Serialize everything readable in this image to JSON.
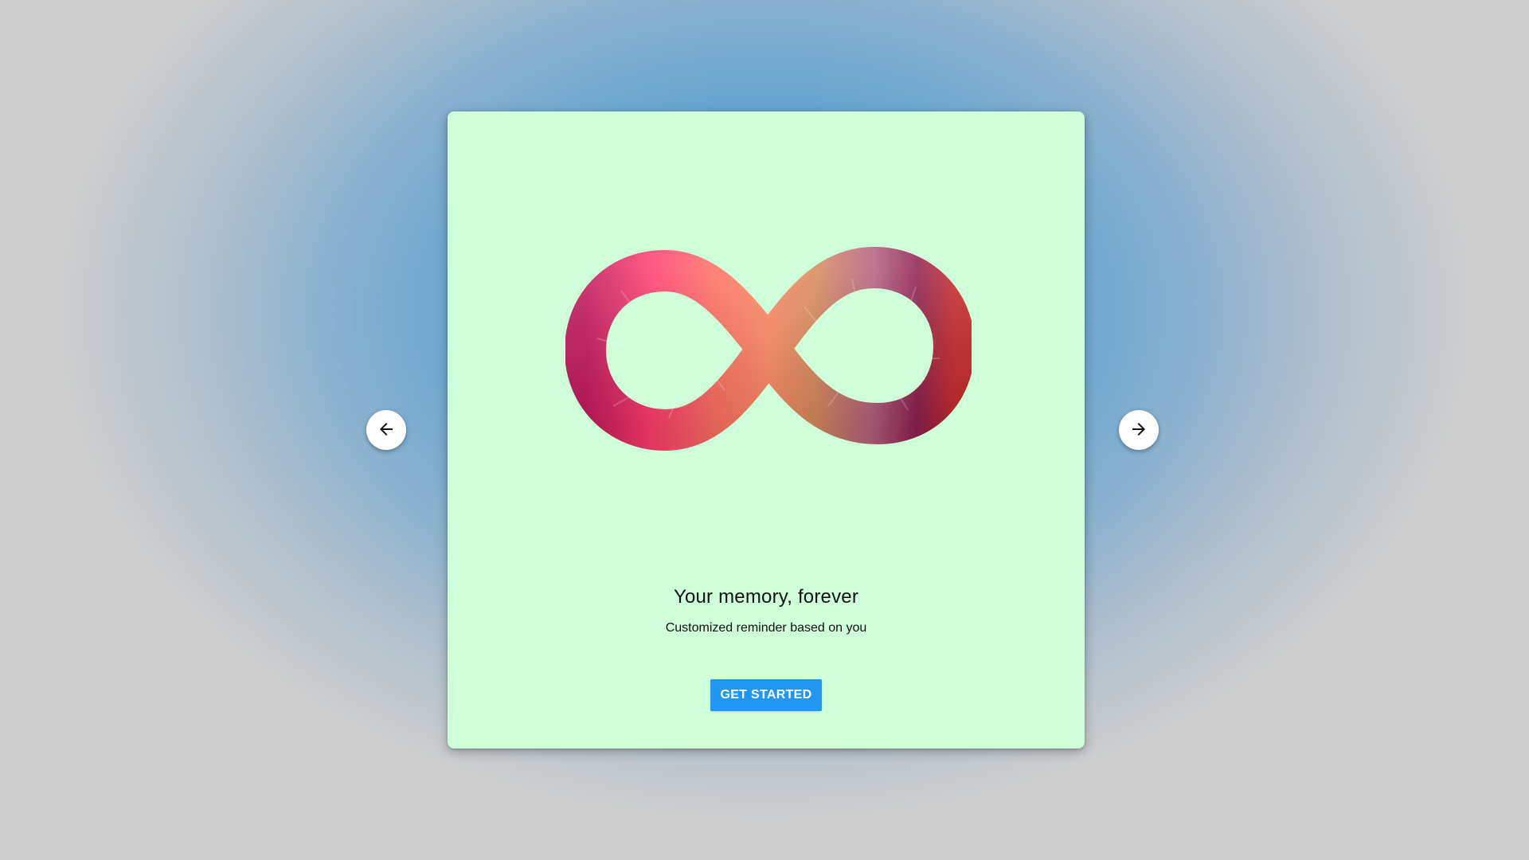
{
  "slide": {
    "title": "Your memory, forever",
    "subtitle": "Customized reminder based on you",
    "cta_label": "GET STARTED",
    "illustration": "infinity-icon",
    "background_color": "#ceffd9"
  },
  "navigation": {
    "prev_icon": "arrow-left-icon",
    "next_icon": "arrow-right-icon"
  },
  "colors": {
    "accent": "#2196f3",
    "page_background_center": "#5aa1d1",
    "page_background_edge": "#cfcfcf"
  }
}
